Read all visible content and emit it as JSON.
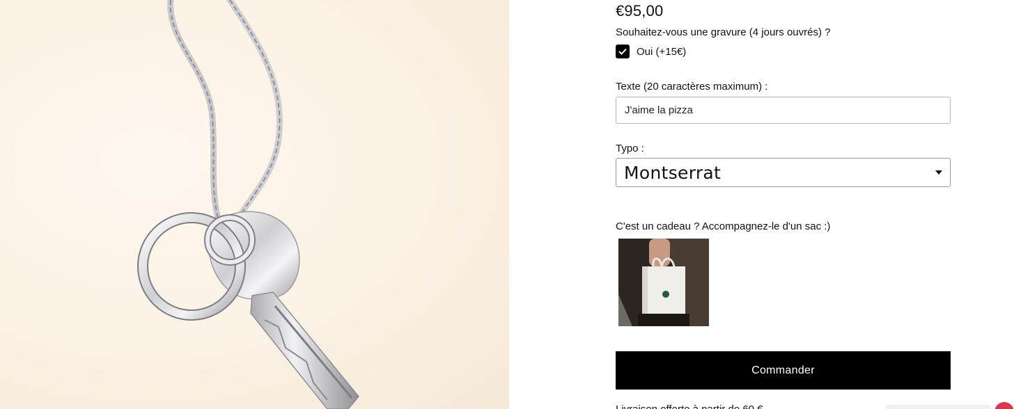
{
  "product": {
    "price": "€95,00",
    "image_alt": "silver-keychain-with-key"
  },
  "engraving": {
    "question": "Souhaitez-vous une gravure (4 jours ouvrés) ?",
    "option_label": "Oui (+15€)",
    "checked": true,
    "text_label": "Texte (20 caractères maximum) :",
    "text_value": "J'aime la pizza",
    "font_label": "Typo :",
    "font_value": "Montserrat"
  },
  "gift": {
    "prompt": "C'est un cadeau ? Accompagnez-le d'un sac :)",
    "thumbnail": "gift-bag-photo"
  },
  "cta": {
    "order_label": "Commander"
  },
  "footer": {
    "partial_text": "Livraison offerte à partir de 60 €"
  },
  "colors": {
    "accent": "#000000",
    "background_photo": "#fbf1e4",
    "widget": "#e3344f"
  }
}
